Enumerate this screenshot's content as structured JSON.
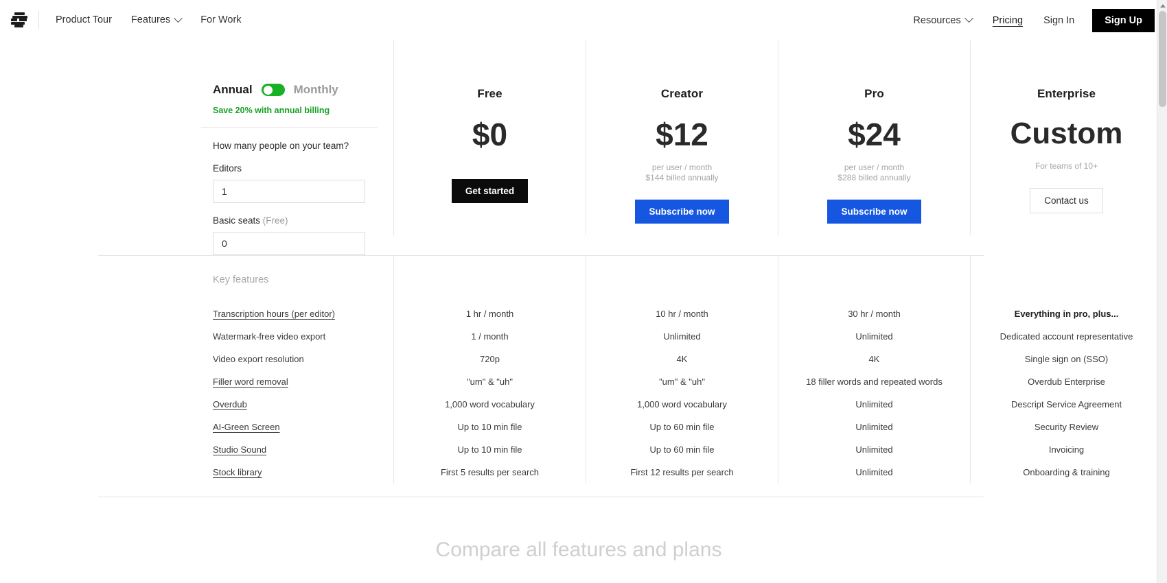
{
  "header": {
    "logo_name": "descript-logo",
    "nav_left": [
      {
        "label": "Product Tour",
        "has_chevron": false
      },
      {
        "label": "Features",
        "has_chevron": true
      },
      {
        "label": "For Work",
        "has_chevron": false
      }
    ],
    "nav_right": [
      {
        "label": "Resources",
        "has_chevron": true
      }
    ],
    "pricing_label": "Pricing",
    "signin_label": "Sign In",
    "signup_label": "Sign Up",
    "signup_bg": "#000000"
  },
  "sidebar": {
    "toggle": {
      "annual_label": "Annual",
      "monthly_label": "Monthly",
      "selected": "Annual",
      "track_color": "#17b126"
    },
    "save_note": "Save 20% with annual billing",
    "save_note_color": "#16a024",
    "team_question": "How many people on your team?",
    "editors_label": "Editors",
    "editors_value": "1",
    "basic_seats_label": "Basic seats",
    "basic_seats_muted": " (Free)",
    "basic_seats_value": "0"
  },
  "plans": [
    {
      "name": "Free",
      "price": "$0",
      "sub_line1": "",
      "sub_line2": "",
      "cta_label": "Get started",
      "cta_style": "dark"
    },
    {
      "name": "Creator",
      "price": "$12",
      "sub_line1": "per user / month",
      "sub_line2": "$144 billed annually",
      "cta_label": "Subscribe now",
      "cta_style": "blue"
    },
    {
      "name": "Pro",
      "price": "$24",
      "sub_line1": "per user / month",
      "sub_line2": "$288 billed annually",
      "cta_label": "Subscribe now",
      "cta_style": "blue"
    },
    {
      "name": "Enterprise",
      "price": "Custom",
      "sub_line1": "For teams of 10+",
      "sub_line2": "",
      "cta_label": "Contact us",
      "cta_style": "ghost"
    }
  ],
  "features": {
    "section_title": "Key features",
    "rows": [
      {
        "label": "Transcription hours (per editor)",
        "underlined": true,
        "free": "1 hr / month",
        "creator": "10 hr / month",
        "pro": "30 hr / month",
        "enterprise": "Everything in pro, plus...",
        "enterprise_bold": true
      },
      {
        "label": "Watermark-free video export",
        "underlined": false,
        "free": "1 / month",
        "creator": "Unlimited",
        "pro": "Unlimited",
        "enterprise": "Dedicated account representative",
        "enterprise_bold": false
      },
      {
        "label": "Video export resolution",
        "underlined": false,
        "free": "720p",
        "creator": "4K",
        "pro": "4K",
        "enterprise": "Single sign on (SSO)",
        "enterprise_bold": false
      },
      {
        "label": "Filler word removal",
        "underlined": true,
        "free": "\"um\" & \"uh\"",
        "creator": "\"um\" & \"uh\"",
        "pro": "18 filler words and repeated words",
        "enterprise": "Overdub Enterprise",
        "enterprise_bold": false
      },
      {
        "label": "Overdub",
        "underlined": true,
        "free": "1,000 word vocabulary",
        "creator": "1,000 word vocabulary",
        "pro": "Unlimited",
        "enterprise": "Descript Service Agreement",
        "enterprise_bold": false
      },
      {
        "label": "AI-Green Screen",
        "underlined": true,
        "free": "Up to 10 min file",
        "creator": "Up to 60 min file",
        "pro": "Unlimited",
        "enterprise": "Security Review",
        "enterprise_bold": false
      },
      {
        "label": "Studio Sound",
        "underlined": true,
        "free": "Up to 10 min file",
        "creator": "Up to 60 min file",
        "pro": "Unlimited",
        "enterprise": "Invoicing",
        "enterprise_bold": false
      },
      {
        "label": "Stock library",
        "underlined": true,
        "free": "First 5 results per search",
        "creator": "First 12 results per search",
        "pro": "Unlimited",
        "enterprise": "Onboarding & training",
        "enterprise_bold": false
      }
    ]
  },
  "compare_section_title": "Compare all features and plans"
}
